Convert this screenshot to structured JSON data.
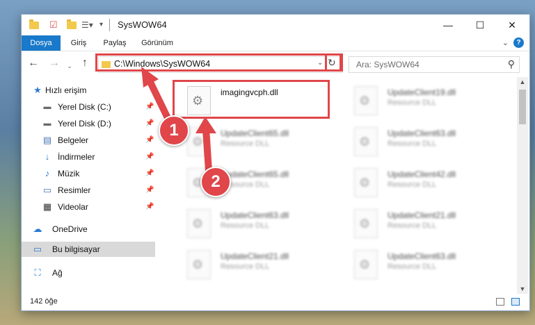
{
  "window": {
    "title": "SysWOW64",
    "controls": {
      "minimize": "—",
      "maximize": "☐",
      "close": "✕"
    }
  },
  "ribbon": {
    "tabs": [
      {
        "label": "Dosya",
        "active": true
      },
      {
        "label": "Giriş"
      },
      {
        "label": "Paylaş"
      },
      {
        "label": "Görünüm"
      }
    ],
    "help": "?"
  },
  "nav": {
    "address": "C:\\Windows\\SysWOW64",
    "search_placeholder": "Ara: SysWOW64"
  },
  "sidebar": {
    "items": [
      {
        "label": "Hızlı erişim",
        "icon": "star-icon"
      },
      {
        "label": "Yerel Disk (C:)",
        "icon": "drive-icon",
        "pinned": true
      },
      {
        "label": "Yerel Disk (D:)",
        "icon": "drive-icon",
        "pinned": true
      },
      {
        "label": "Belgeler",
        "icon": "documents-icon",
        "pinned": true
      },
      {
        "label": "İndirmeler",
        "icon": "download-icon",
        "pinned": true
      },
      {
        "label": "Müzik",
        "icon": "music-icon",
        "pinned": true
      },
      {
        "label": "Resimler",
        "icon": "pictures-icon",
        "pinned": true
      },
      {
        "label": "Videolar",
        "icon": "videos-icon",
        "pinned": true
      },
      {
        "label": "OneDrive",
        "icon": "cloud-icon"
      },
      {
        "label": "Bu bilgisayar",
        "icon": "computer-icon",
        "selected": true
      },
      {
        "label": "Ağ",
        "icon": "network-icon"
      }
    ]
  },
  "files": [
    {
      "name": "imagingvcph.dll",
      "type": ""
    },
    {
      "name": "UpdateClient19.dll",
      "type": "Resource DLL"
    },
    {
      "name": "UpdateClient65.dll",
      "type": "Resource DLL"
    },
    {
      "name": "UpdateClient63.dll",
      "type": "Resource DLL"
    },
    {
      "name": "UpdateClient65.dll",
      "type": "Resource DLL"
    },
    {
      "name": "UpdateClient42.dll",
      "type": "Resource DLL"
    },
    {
      "name": "UpdateClient63.dll",
      "type": "Resource DLL"
    },
    {
      "name": "UpdateClient21.dll",
      "type": "Resource DLL"
    },
    {
      "name": "UpdateClient21.dll",
      "type": "Resource DLL"
    },
    {
      "name": "UpdateClient63.dll",
      "type": "Resource DLL"
    }
  ],
  "status": {
    "count": "142 öğe"
  },
  "annotations": {
    "step1": "1",
    "step2": "2",
    "highlight_color": "#e0464a"
  },
  "colors": {
    "accent": "#1979ca",
    "folder": "#f2c94c"
  }
}
